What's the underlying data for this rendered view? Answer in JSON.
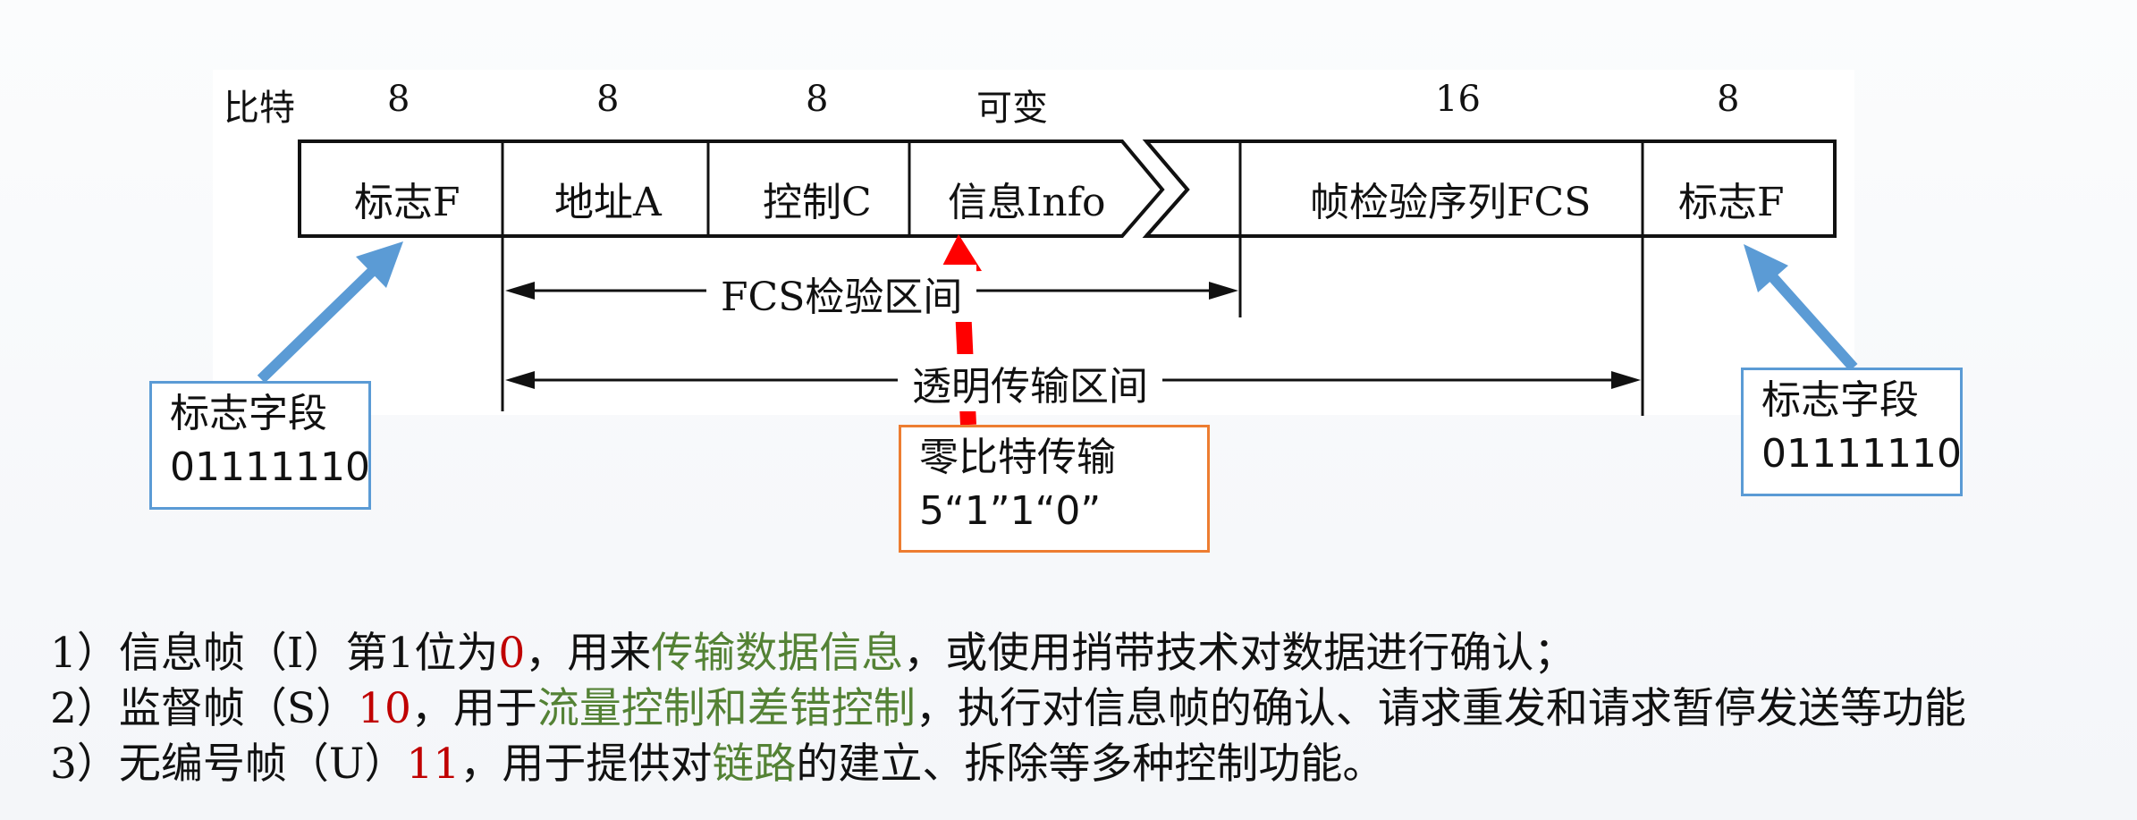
{
  "frame": {
    "bits_label": "比特",
    "bits": [
      "8",
      "8",
      "8",
      "可变",
      "16",
      "8"
    ],
    "fields": [
      "标志F",
      "地址A",
      "控制C",
      "信息Info",
      "帧检验序列FCS",
      "标志F"
    ]
  },
  "ranges": {
    "fcs": "FCS检验区间",
    "transparent": "透明传输区间"
  },
  "callouts": {
    "left": {
      "title": "标志字段",
      "value": "01111110"
    },
    "middle": {
      "title": "零比特传输",
      "value": "5“1”1“0”"
    },
    "right": {
      "title": "标志字段",
      "value": "01111110"
    }
  },
  "notes": [
    {
      "a": "1）信息帧（I）第1位为",
      "b": "0",
      "c": "，用来",
      "d": "传输数据信息",
      "e": "，或使用捎带技术对数据进行确认；"
    },
    {
      "a": "2）监督帧（S）",
      "b": "10",
      "c": "，用于",
      "d": "流量控制和差错控制",
      "e": "，执行对信息帧的确认、请求重发和请求暂停发送等功能"
    },
    {
      "a": "3）无编号帧（U）",
      "b": "11",
      "c": "，用于提供对",
      "d": "链路",
      "e": "的建立、拆除等多种控制功能。"
    }
  ],
  "colors": {
    "arrow_blue": "#5b9bd5",
    "arrow_red": "#ff0000",
    "highlight_red": "#c00000",
    "highlight_green": "#548235",
    "callout_orange": "#ed7d31"
  }
}
